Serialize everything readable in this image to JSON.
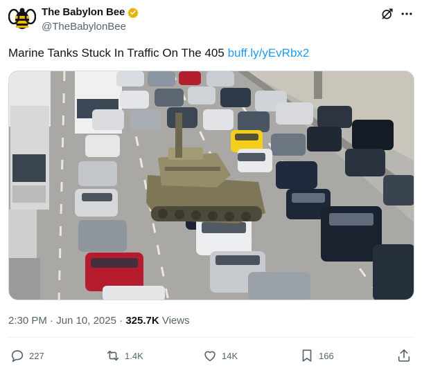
{
  "author": {
    "name": "The Babylon Bee",
    "handle": "@TheBabylonBee",
    "verified_badge_color": "#e8b30a",
    "avatar_icon": "bee-logo-icon"
  },
  "tweet": {
    "text": "Marine Tanks Stuck In Traffic On The 405",
    "link": "buff.ly/yEvRbx2",
    "link_color": "#1d9bf0"
  },
  "meta": {
    "time": "2:30 PM",
    "date": "Jun 10, 2025",
    "separator": "·",
    "views_count": "325.7K",
    "views_label": "Views"
  },
  "actions": {
    "replies": "227",
    "reposts": "1.4K",
    "likes": "14K",
    "bookmarks": "166"
  },
  "icons": [
    "bee-logo-icon",
    "verified-icon",
    "grok-icon",
    "more-icon",
    "reply-icon",
    "repost-icon",
    "like-icon",
    "bookmark-icon",
    "share-icon"
  ]
}
